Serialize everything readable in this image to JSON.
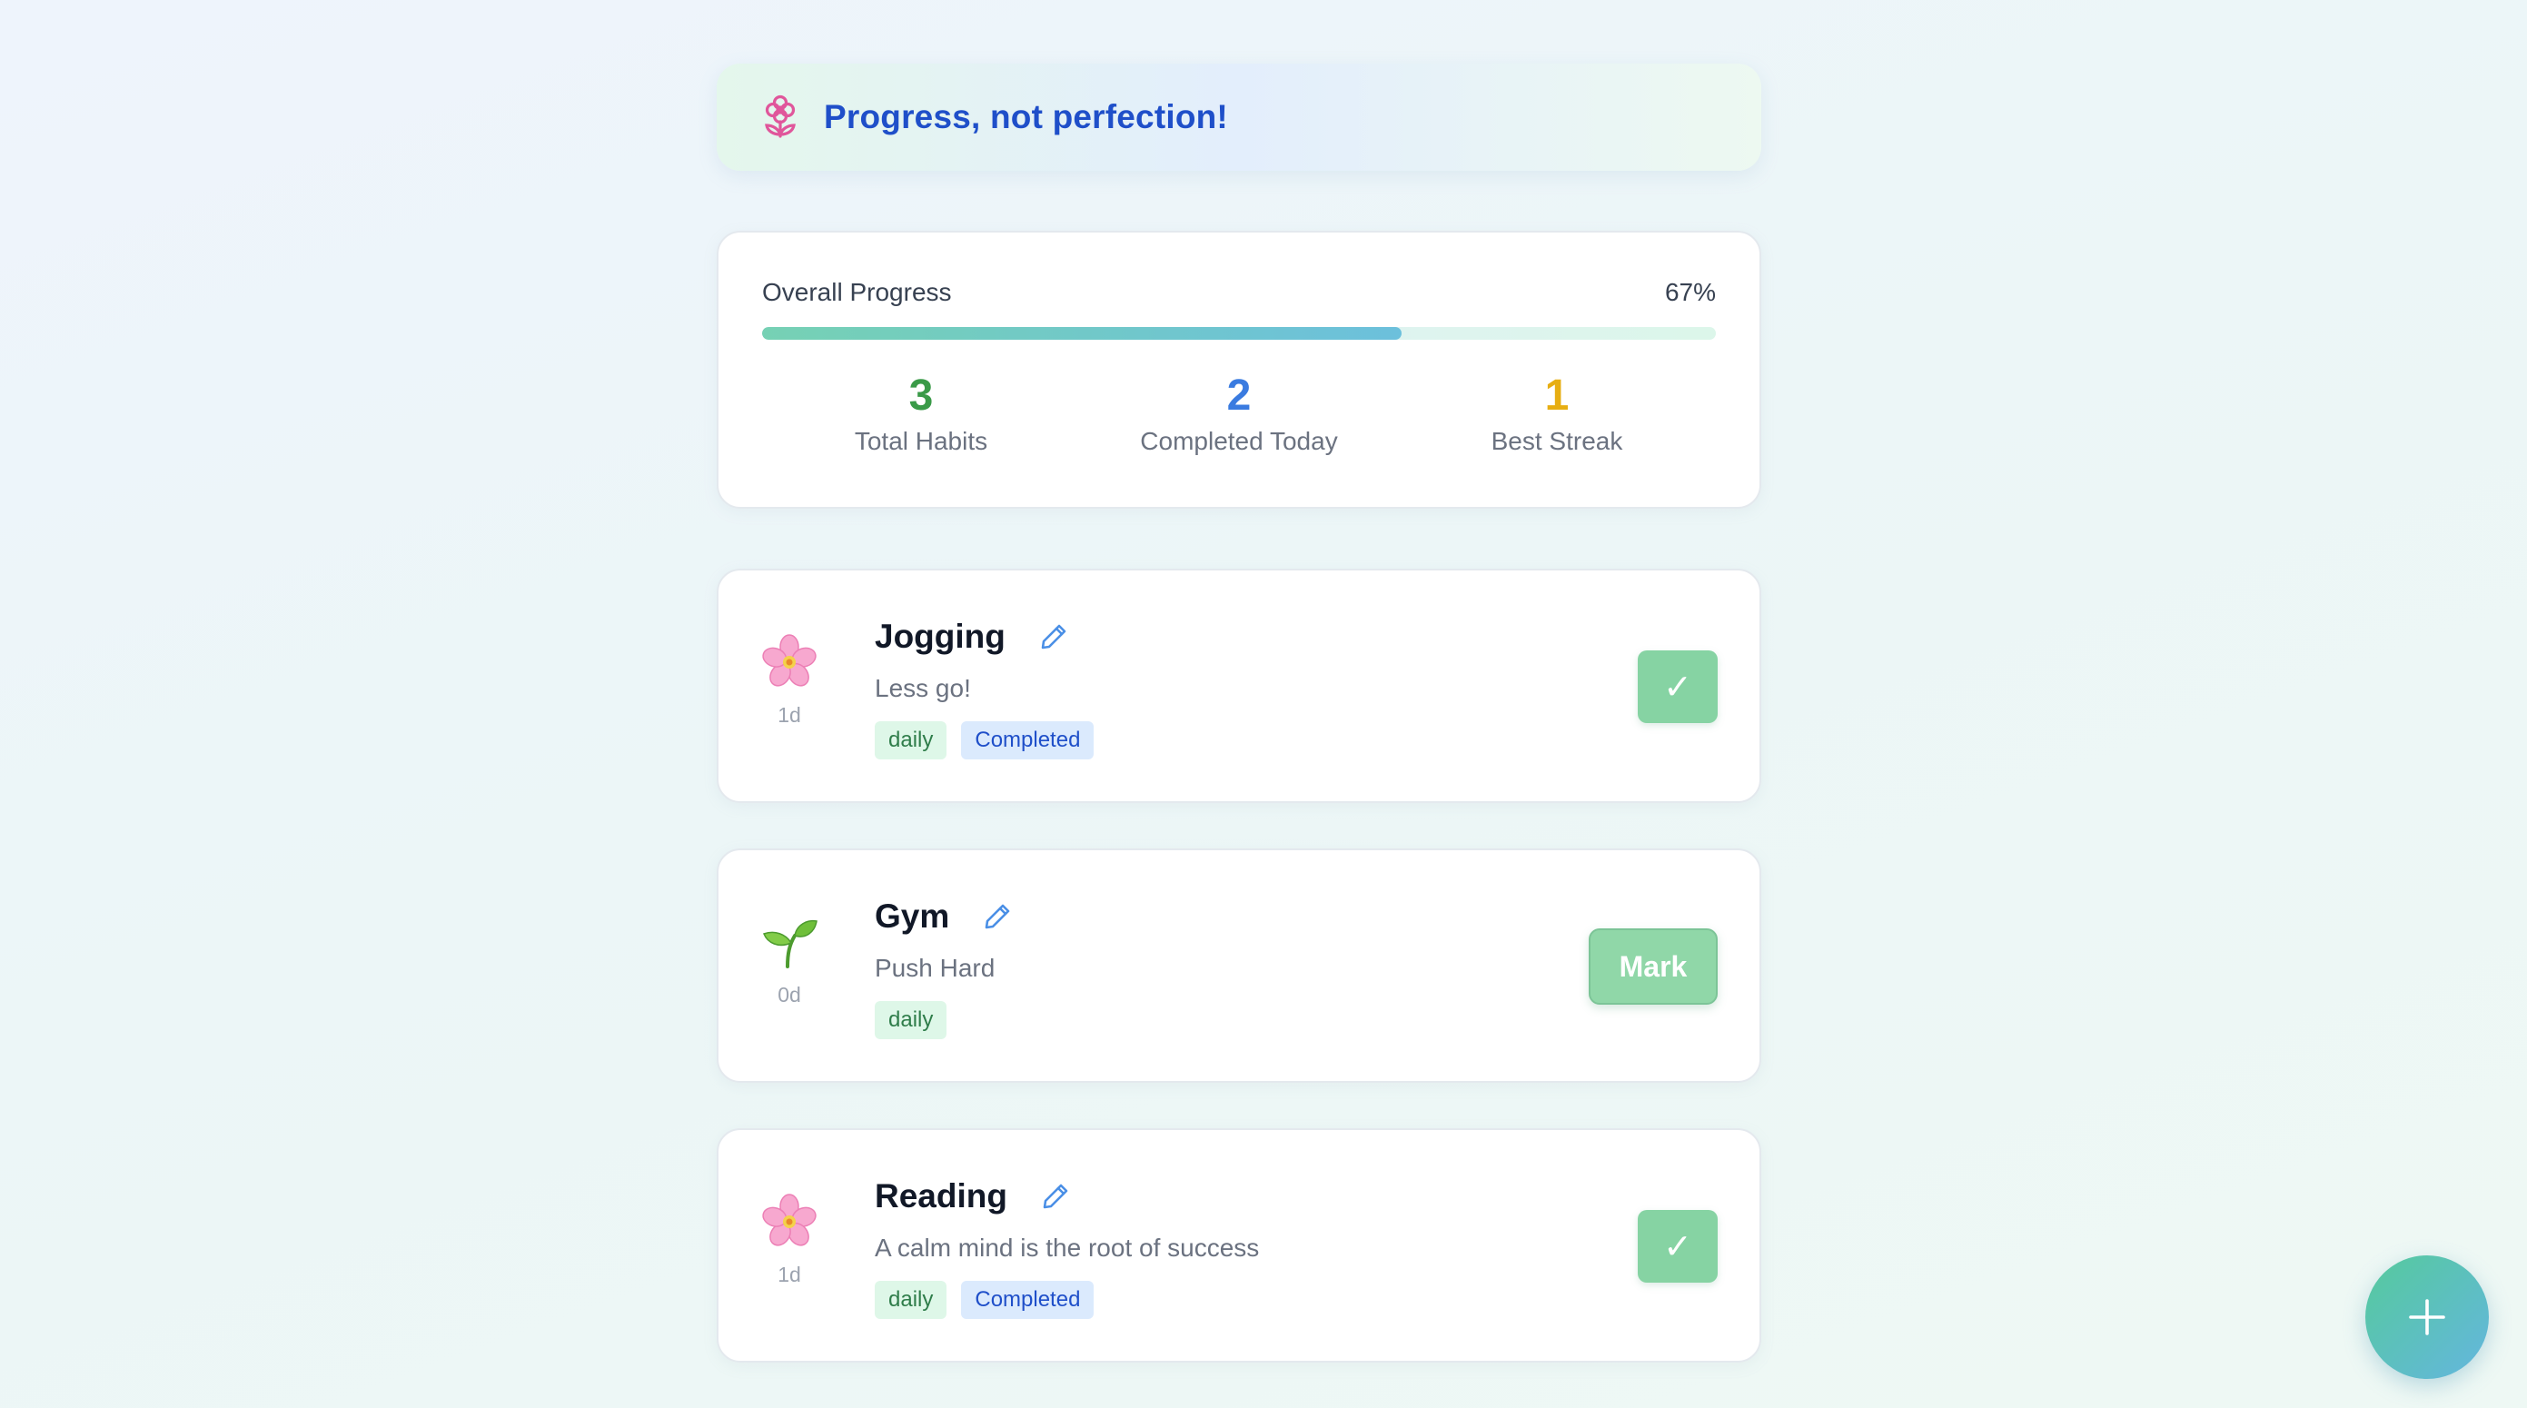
{
  "banner": {
    "text": "Progress, not perfection!",
    "icon": "flower-icon"
  },
  "progress": {
    "label": "Overall Progress",
    "percent_text": "67%",
    "fraction": 0.67,
    "stats": [
      {
        "value": "3",
        "label": "Total Habits",
        "color": "#3a9a48"
      },
      {
        "value": "2",
        "label": "Completed Today",
        "color": "#3a7be0"
      },
      {
        "value": "1",
        "label": "Best Streak",
        "color": "#e7ae12"
      }
    ]
  },
  "habits": [
    {
      "emoji": "cherry-blossom-icon",
      "streak": "1d",
      "title": "Jogging",
      "description": "Less go!",
      "tags": [
        "daily",
        "Completed"
      ],
      "action": "✓"
    },
    {
      "emoji": "seedling-icon",
      "streak": "0d",
      "title": "Gym",
      "description": "Push Hard",
      "tags": [
        "daily"
      ],
      "action": "Mark"
    },
    {
      "emoji": "cherry-blossom-icon",
      "streak": "1d",
      "title": "Reading",
      "description": "A calm mind is the root of success",
      "tags": [
        "daily",
        "Completed"
      ],
      "action": "✓"
    }
  ],
  "fab": {
    "icon": "plus-icon"
  },
  "colors": {
    "accent_blue": "#1f4fc9",
    "button_green": "#86d3a3",
    "tag_daily_bg": "#def7e8",
    "tag_completed_bg": "#dbeafd"
  }
}
